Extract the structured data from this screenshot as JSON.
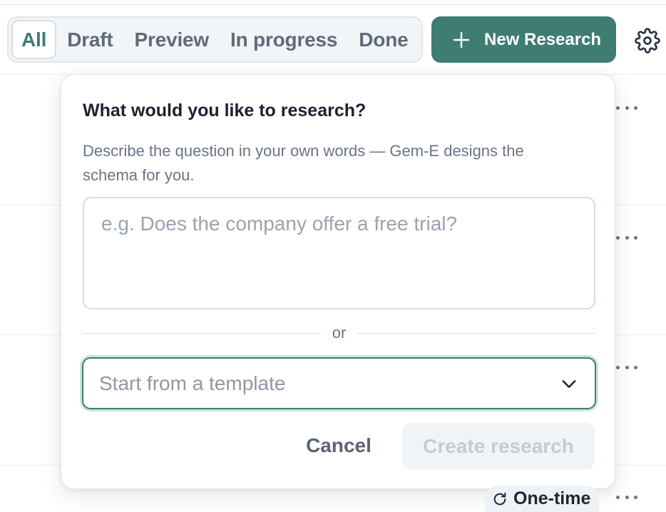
{
  "tabs": [
    {
      "label": "All",
      "active": true
    },
    {
      "label": "Draft",
      "active": false
    },
    {
      "label": "Preview",
      "active": false
    },
    {
      "label": "In progress",
      "active": false
    },
    {
      "label": "Done",
      "active": false
    }
  ],
  "toolbar": {
    "new_research_label": "New Research",
    "new_research_icon": "plus-icon",
    "settings_icon": "gear-icon"
  },
  "popover": {
    "title": "What would you like to research?",
    "description": "Describe the question in your own words — Gem-E designs the schema for you.",
    "question_placeholder": "e.g. Does the company offer a free trial?",
    "question_value": "",
    "divider_label": "or",
    "template_placeholder": "Start from a template",
    "cancel_label": "Cancel",
    "create_label": "Create research"
  },
  "rows": [
    {
      "status": "",
      "menu_icon": "more-horizontal-icon"
    },
    {
      "status": "",
      "menu_icon": "more-horizontal-icon"
    },
    {
      "status": "",
      "menu_icon": "more-horizontal-icon"
    },
    {
      "status": "One-time",
      "status_icon": "refresh-icon",
      "menu_icon": "more-horizontal-icon"
    }
  ],
  "colors": {
    "accent": "#3f7c72",
    "tab_active_text": "#3e7d73",
    "disabled_text": "#c4cbd4"
  }
}
